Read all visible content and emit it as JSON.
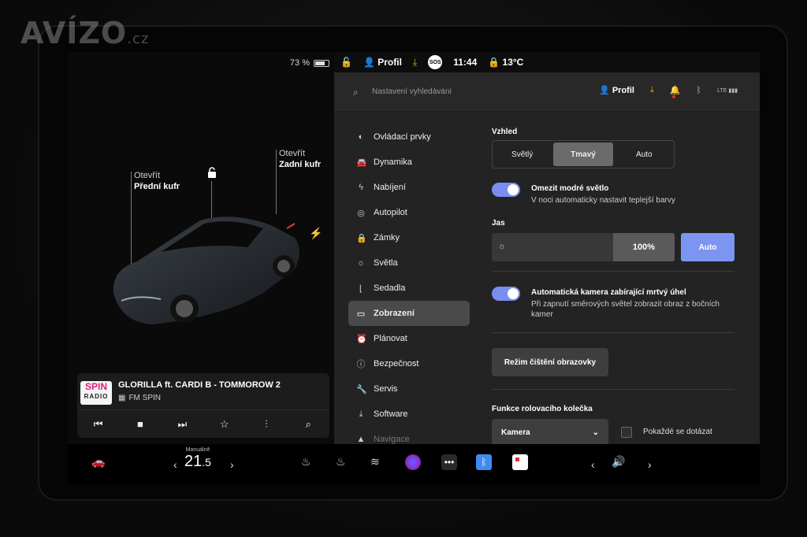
{
  "watermark": {
    "brand": "AVÍZO",
    "suffix": ".cz"
  },
  "status": {
    "battery_percent": "73 %",
    "profile_label": "Profil",
    "time": "11:44",
    "temperature": "13°C",
    "sos_label": "SOS"
  },
  "car": {
    "front_trunk": {
      "action": "Otevřít",
      "name": "Přední kufr"
    },
    "rear_trunk": {
      "action": "Otevřít",
      "name": "Zadní kufr"
    }
  },
  "media": {
    "station_logo_top": "SPIN",
    "station_logo_bottom": "RADIO",
    "song": "GLORILLA ft. CARDI B - TOMMOROW 2",
    "station": "FM SPIN"
  },
  "search": {
    "placeholder": "Nastavení vyhledávání",
    "profile_label": "Profil",
    "lte_label": "LTE"
  },
  "nav": {
    "items": [
      {
        "label": "Ovládací prvky",
        "icon": "toggle-icon"
      },
      {
        "label": "Dynamika",
        "icon": "car-icon"
      },
      {
        "label": "Nabíjení",
        "icon": "bolt-icon"
      },
      {
        "label": "Autopilot",
        "icon": "steering-wheel-icon"
      },
      {
        "label": "Zámky",
        "icon": "lock-icon"
      },
      {
        "label": "Světla",
        "icon": "sun-icon"
      },
      {
        "label": "Sedadla",
        "icon": "seat-icon"
      },
      {
        "label": "Zobrazení",
        "icon": "display-icon"
      },
      {
        "label": "Plánovat",
        "icon": "alarm-icon"
      },
      {
        "label": "Bezpečnost",
        "icon": "info-icon"
      },
      {
        "label": "Servis",
        "icon": "wrench-icon"
      },
      {
        "label": "Software",
        "icon": "download-icon"
      },
      {
        "label": "Navigace",
        "icon": "navigation-icon"
      }
    ],
    "active_index": 7
  },
  "display": {
    "appearance_label": "Vzhled",
    "appearance_options": [
      "Světlý",
      "Tmavý",
      "Auto"
    ],
    "appearance_selected": "Tmavý",
    "blue_light_title": "Omezit modré světlo",
    "blue_light_desc": "V noci automaticky nastavit teplejší barvy",
    "blue_light_on": true,
    "brightness_label": "Jas",
    "brightness_value": "100%",
    "brightness_auto": "Auto",
    "blindspot_title": "Automatická kamera zabírající mrtvý úhel",
    "blindspot_desc": "Při zapnutí směrových světel zobrazit obraz z bočních kamer",
    "blindspot_on": true,
    "clean_mode_button": "Režim čištění obrazovky",
    "scroll_wheel_label": "Funkce rolovacího kolečka",
    "scroll_wheel_value": "Kamera",
    "ask_every_time": "Pokaždé se dotázat"
  },
  "dock": {
    "temp_mode": "Manuálně",
    "temp_value": "21",
    "temp_decimal": ".5"
  },
  "colors": {
    "accent": "#7d95f2",
    "warning": "#f0a020",
    "active_nav": "#4a4a4a"
  }
}
